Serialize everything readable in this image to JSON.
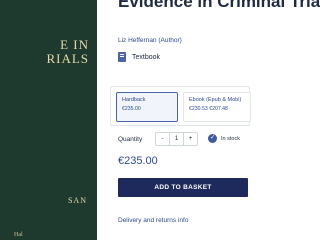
{
  "product": {
    "title": "Evidence in Criminal Trials",
    "author_link": "Liz Heffernan (Author)",
    "format_label": "Textbook",
    "price": "€235.00"
  },
  "cover": {
    "line1": "E IN",
    "line2": "RIALS",
    "author": "SAN",
    "small": "Hal"
  },
  "format_options": [
    {
      "name": "Hardback",
      "price": "€235.00"
    },
    {
      "name": "Ebook (Epub & Mobi)",
      "price": "€230.53 €207.48"
    }
  ],
  "quantity": {
    "label": "Quantity",
    "minus": "-",
    "value": "1",
    "plus": "+"
  },
  "stock": {
    "label": "In stock"
  },
  "actions": {
    "add_to_basket": "ADD TO BASKET"
  },
  "links": {
    "delivery": "Delivery and returns info"
  },
  "colors": {
    "accent": "#2c4a9a",
    "button": "#1f2a5c",
    "cover": "#1e3a2e"
  },
  "icons": {
    "format": "book-icon",
    "stock": "check-icon"
  }
}
